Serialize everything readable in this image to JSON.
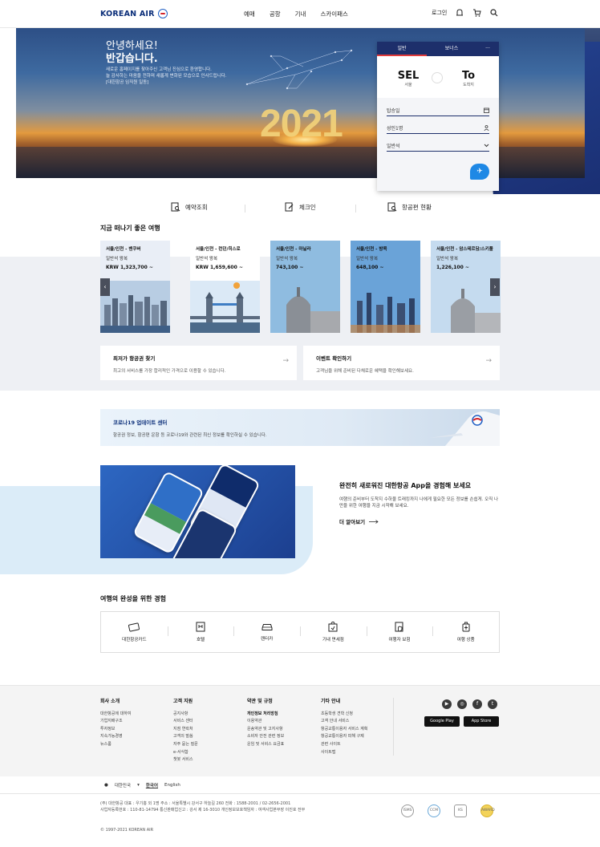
{
  "header": {
    "logo": "KOREAN AIR",
    "nav": [
      "예매",
      "공항",
      "기내",
      "스카이패스"
    ],
    "login": "로그인"
  },
  "hero": {
    "greeting": "안녕하세요!",
    "greeting2": "반갑습니다.",
    "message_lines": [
      "새로운 홈페이지를 찾아주신 고객님 진심으로 환영합니다.",
      "늘 감사하는 마음을 전하며 새롭게 변화된 모습으로 인사드립니다.",
      "[대한항공 임직원 일동]"
    ],
    "year": "2021"
  },
  "booking": {
    "tabs": [
      "일반",
      "보너스",
      "···"
    ],
    "from_code": "SEL",
    "from_name": "서울",
    "to_code": "To",
    "to_name": "도착지",
    "date_field": "탑승일",
    "passenger_field": "성인1명",
    "class_field": "일반석"
  },
  "quick_links": [
    "예약조회",
    "체크인",
    "항공편 현황"
  ],
  "destinations": {
    "title": "지금 떠나기 좋은 여행",
    "items": [
      {
        "route": "서울/인천 - 밴쿠버",
        "class": "일반석 왕복",
        "price": "KRW 1,323,700 ~"
      },
      {
        "route": "서울/인천 - 런던/히스로",
        "class": "일반석 왕복",
        "price": "KRW 1,659,600 ~"
      },
      {
        "route": "서울/인천 - 마닐라",
        "class": "일반석 왕복",
        "price": "743,100 ~"
      },
      {
        "route": "서울/인천 - 방콕",
        "class": "일반석 왕복",
        "price": "648,100 ~"
      },
      {
        "route": "서울/인천 - 암스테르담/스키폴",
        "class": "일반석 왕복",
        "price": "1,226,100 ~"
      }
    ]
  },
  "info_cards": [
    {
      "title": "최저가 항공권 찾기",
      "desc": "최고의 서비스를 가장 합리적인 가격으로 이용할 수 있습니다."
    },
    {
      "title": "이벤트 확인하기",
      "desc": "고객님을 위해 준비된 다채로운 혜택을 확인해보세요."
    }
  ],
  "covid": {
    "title": "코로나19 업데이트 센터",
    "desc": "항공권 정보, 항공편 운항 등 코로나19와 관련된 최신 정보를 확인하실 수 있습니다."
  },
  "app": {
    "title": "완전히 새로워진 대한항공 App을 경험해 보세요",
    "desc": "여행의 준비부터 도착지 수하물 트래킹까지 나에게 필요한 모든 정보를 손쉽게. 오직 나만을 위한 여행을 지금 시작해 보세요.",
    "more": "더 알아보기"
  },
  "experiences": {
    "title": "여행의 완성을 위한 경험",
    "items": [
      "대한항공카드",
      "호텔",
      "렌터카",
      "기내 면세점",
      "여행자 보험",
      "여행 상품"
    ]
  },
  "footer": {
    "columns": [
      {
        "title": "회사 소개",
        "items": [
          "대한항공에 대하여",
          "기업지배구조",
          "투자정보",
          "지속가능경영",
          "뉴스룸"
        ]
      },
      {
        "title": "고객 지원",
        "items": [
          "공지사항",
          "서비스 센터",
          "지점 연락처",
          "고객의 말씀",
          "자주 묻는 질문",
          "e-서식함",
          "챗봇 서비스"
        ]
      },
      {
        "title": "약관 및 규정",
        "items": [
          "개인정보 처리방침",
          "이용약관",
          "운송약관 및 고지사항",
          "소비자 안전 관련 정보",
          "운임 및 서비스 요금표"
        ]
      },
      {
        "title": "기타 안내",
        "items": [
          "초등학생 견학 신청",
          "고객 안내 서비스",
          "항공교통이용자 서비스 계획",
          "항공교통이용자 피해 구제",
          "관련 사이트",
          "사이트맵"
        ]
      }
    ],
    "stores": [
      "Google Play",
      "App Store"
    ],
    "language": {
      "country": "대한민국",
      "korean": "한국어",
      "english": "English"
    },
    "corp_lines": [
      "(주) 대한항공    대표 : 우기홍 외 1명 주소 : 서울특별시 강서구 하늘길 260 전화 : 1588-2001 / 02-2656-2001",
      "사업자등록번호 : 110-81-14794 통신판매업신고 : 강서 제 16-3010 개인정보보호책임자 : 여객사업본부장 이진호 전무"
    ],
    "copyright": "© 1997-2021 KOREAN AIR",
    "certs": [
      "ISMS",
      "CCM",
      "KS",
      "AWARD"
    ]
  }
}
